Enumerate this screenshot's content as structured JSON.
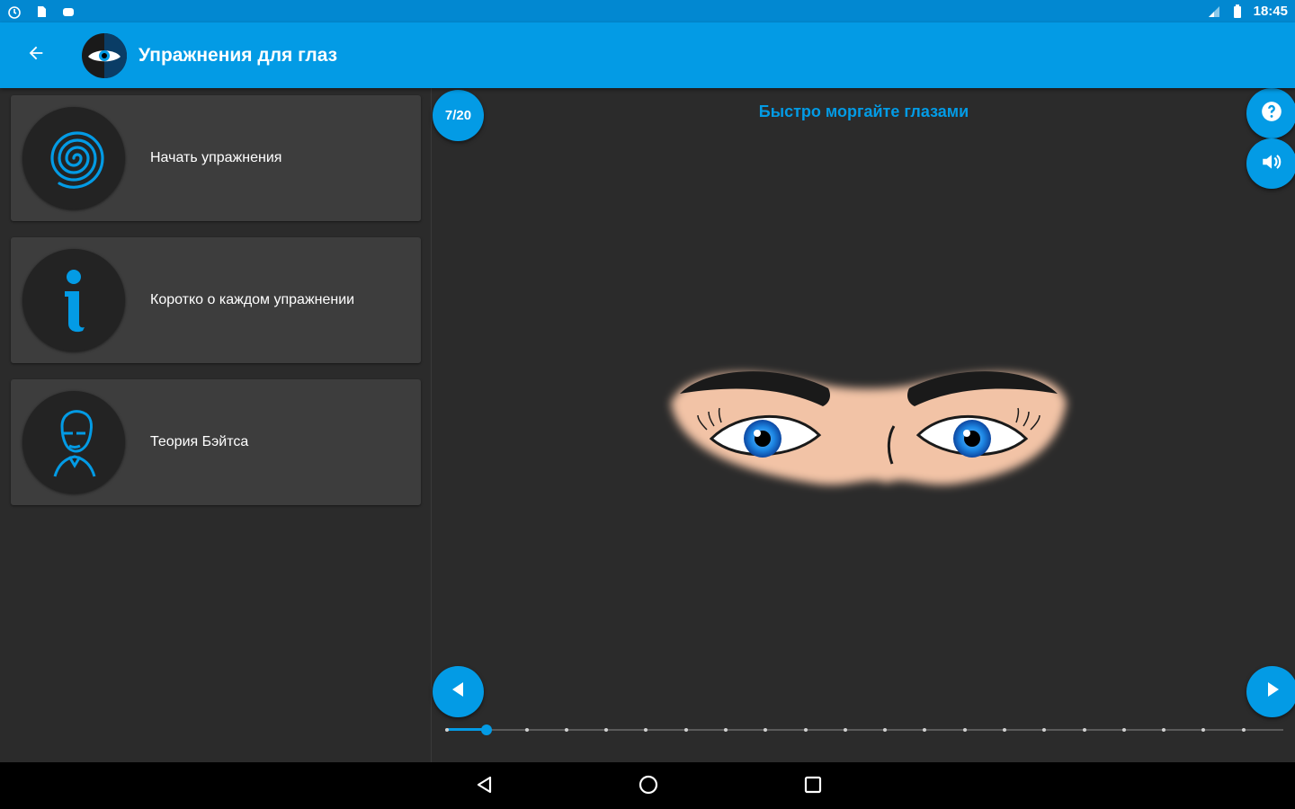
{
  "status_bar": {
    "time": "18:45",
    "left_icons": [
      "alarm-icon",
      "sd-card-icon",
      "notification-icon"
    ],
    "right_icons": [
      "signal-icon",
      "battery-icon"
    ]
  },
  "app_bar": {
    "title": "Упражнения для глаз",
    "back_icon": "arrow-back-icon",
    "logo_icon": "eye-logo-icon"
  },
  "menu": {
    "items": [
      {
        "label": "Начать упражнения",
        "icon": "spiral-icon"
      },
      {
        "label": "Коротко о каждом упражнении",
        "icon": "info-icon"
      },
      {
        "label": "Теория Бэйтса",
        "icon": "bates-portrait-icon"
      }
    ]
  },
  "exercise": {
    "counter": "7/20",
    "title": "Быстро моргайте глазами",
    "current": 2,
    "total": 20
  },
  "colors": {
    "accent": "#039be5",
    "status_bar": "#0288d1",
    "background": "#2b2b2b",
    "card": "#3d3d3d"
  }
}
